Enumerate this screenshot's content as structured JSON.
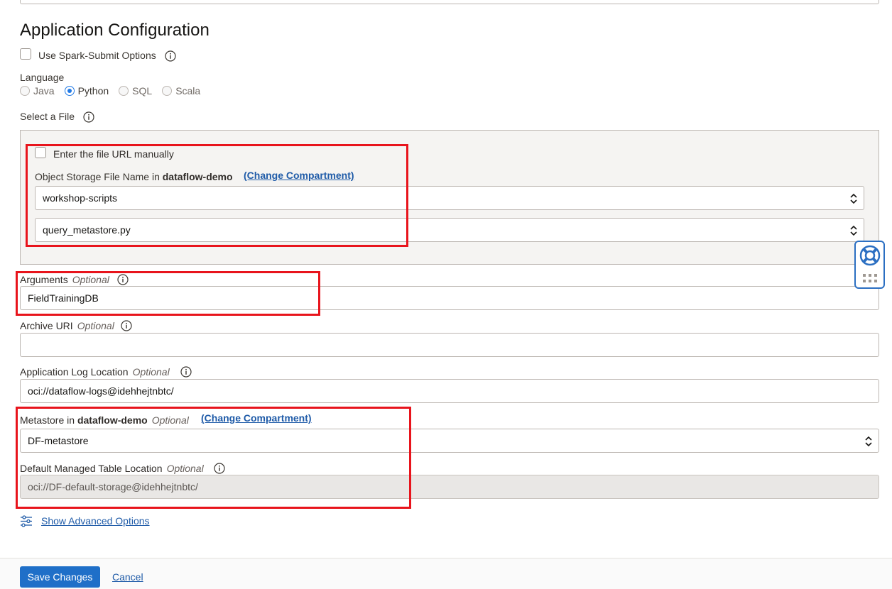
{
  "section_title": "Application Configuration",
  "spark_submit": {
    "label": "Use Spark-Submit Options",
    "checked": false
  },
  "language": {
    "label": "Language",
    "options": [
      "Java",
      "Python",
      "SQL",
      "Scala"
    ],
    "selected": "Python"
  },
  "select_file": {
    "label": "Select a File",
    "manual_url_label": "Enter the file URL manually",
    "object_storage_label": "Object Storage File Name in",
    "compartment": "dataflow-demo",
    "change_compartment": "(Change Compartment)",
    "bucket": "workshop-scripts",
    "file": "query_metastore.py"
  },
  "arguments": {
    "label": "Arguments",
    "optional": "Optional",
    "value": "FieldTrainingDB"
  },
  "archive_uri": {
    "label": "Archive URI",
    "optional": "Optional",
    "value": ""
  },
  "log_location": {
    "label": "Application Log Location",
    "optional": "Optional",
    "value": "oci://dataflow-logs@idehhejtnbtc/"
  },
  "metastore": {
    "label": "Metastore in",
    "compartment": "dataflow-demo",
    "optional": "Optional",
    "change_compartment": "(Change Compartment)",
    "value": "DF-metastore"
  },
  "default_table_location": {
    "label": "Default Managed Table Location",
    "optional": "Optional",
    "value": "oci://DF-default-storage@idehhejtnbtc/"
  },
  "advanced_options": "Show Advanced Options",
  "footer": {
    "save": "Save Changes",
    "cancel": "Cancel"
  },
  "colors": {
    "accent": "#1f6fc8",
    "highlight": "#e8141c",
    "link": "#1f5ba8"
  }
}
